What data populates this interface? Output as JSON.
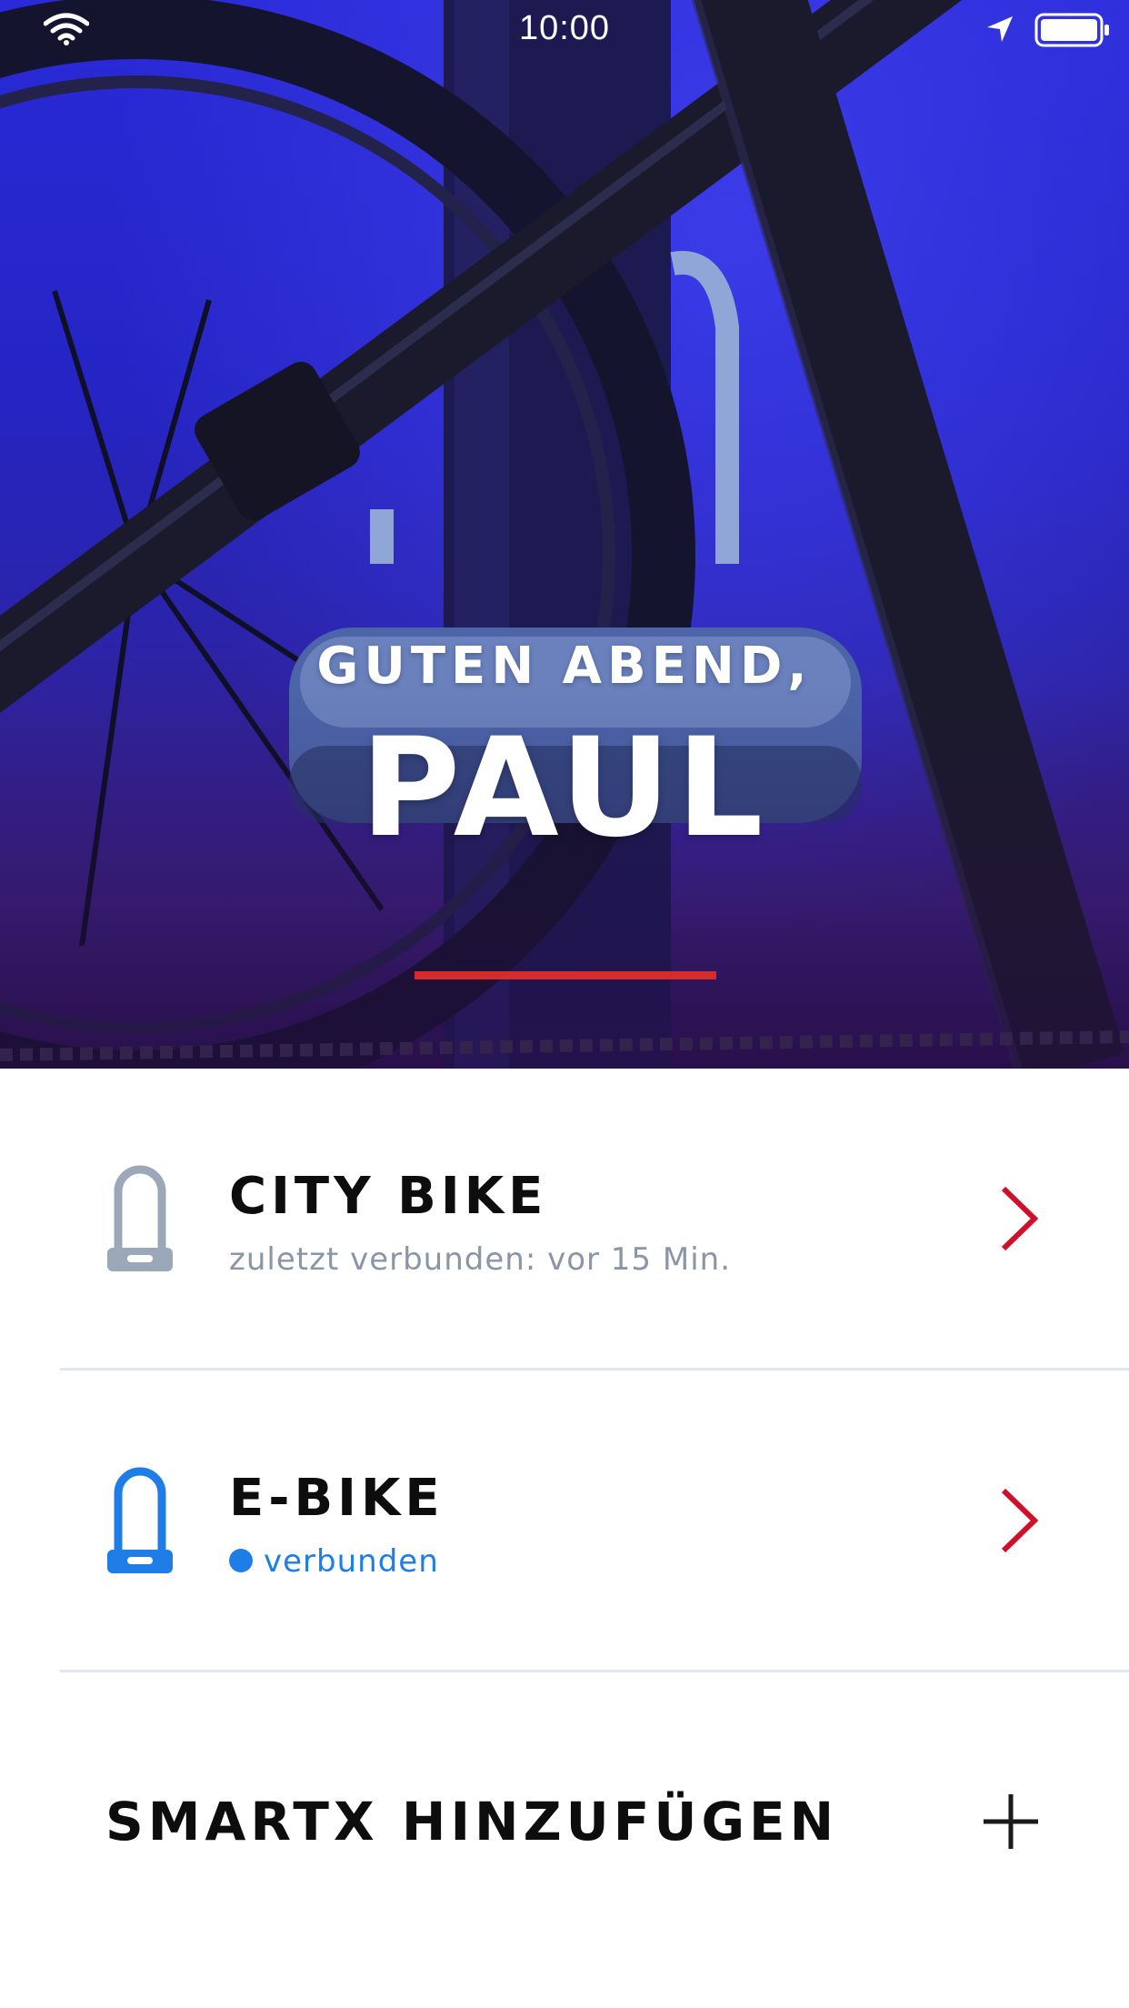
{
  "status_bar": {
    "time": "10:00",
    "wifi_icon": "wifi-icon",
    "location_icon": "location-arrow-icon",
    "battery_icon": "battery-full-icon"
  },
  "hero": {
    "greeting": "GUTEN ABEND,",
    "user_name": "PAUL",
    "accent_color": "#d52b2b"
  },
  "devices": [
    {
      "name": "CITY BIKE",
      "status": "zuletzt verbunden: vor 15 Min.",
      "connected": false,
      "icon": "padlock-icon",
      "icon_color": "#9aa8b9",
      "chevron_color": "#d0102a"
    },
    {
      "name": "E-BIKE",
      "status": "verbunden",
      "connected": true,
      "icon": "padlock-icon",
      "icon_color": "#1e7de6",
      "chevron_color": "#d0102a"
    }
  ],
  "add_device": {
    "label": "SMARTX HINZUFÜGEN",
    "icon": "plus-icon"
  }
}
